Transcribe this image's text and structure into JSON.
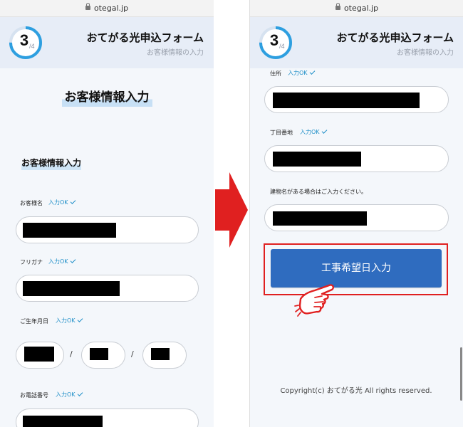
{
  "url": "otegal.jp",
  "header": {
    "step_current": "3",
    "step_total": "/4",
    "title": "おてがる光申込フォーム",
    "subtitle": "お客様情報の入力"
  },
  "left": {
    "page_title": "お客様情報入力",
    "section_title": "お客様情報入力",
    "fields": {
      "name_label": "お客様名",
      "kana_label": "フリガナ",
      "birth_label": "ご生年月日",
      "phone_label": "お電話番号"
    },
    "ok_label": "入力OK",
    "date_separator": "/"
  },
  "right": {
    "fields": {
      "address_label": "住所",
      "chome_label": "丁目番地",
      "building_label": "建物名がある場合はご入力ください。"
    },
    "ok_label": "入力OK",
    "submit_label": "工事希望日入力",
    "copyright": "Copyright(c) おてがる光 All rights reserved."
  },
  "colors": {
    "header_bg": "#e7edf7",
    "progress_ring": "#2e9fe0",
    "ok_badge": "#1f8fc8",
    "submit_button": "#2f6cbf",
    "highlight_border": "#e02020",
    "arrow": "#e02020"
  },
  "icons": {
    "lock": "lock-icon",
    "check": "check-icon",
    "arrow": "right-arrow-icon",
    "hand": "pointing-hand-icon"
  }
}
